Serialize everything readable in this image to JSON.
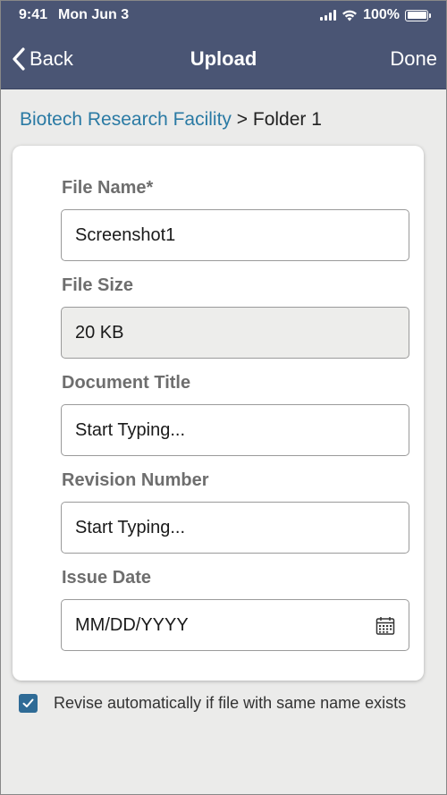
{
  "status": {
    "time": "9:41",
    "date": "Mon Jun 3",
    "battery": "100%"
  },
  "nav": {
    "back_label": "Back",
    "title": "Upload",
    "done_label": "Done"
  },
  "breadcrumb": {
    "parent": "Biotech Research Facility",
    "separator": " > ",
    "current": "Folder 1"
  },
  "form": {
    "file_name": {
      "label": "File Name*",
      "value": "Screenshot1"
    },
    "file_size": {
      "label": "File Size",
      "value": "20 KB"
    },
    "document_title": {
      "label": "Document Title",
      "placeholder": "Start Typing..."
    },
    "revision_number": {
      "label": "Revision Number",
      "placeholder": "Start Typing..."
    },
    "issue_date": {
      "label": "Issue Date",
      "placeholder": "MM/DD/YYYY"
    }
  },
  "revise": {
    "label": "Revise automatically if file with same name exists",
    "checked": true
  },
  "colors": {
    "header": "#4a5574",
    "link": "#2a7aa4",
    "checkbox": "#2f6b96"
  },
  "icons": [
    "chevron-left-icon",
    "wifi-icon",
    "signal-icon",
    "battery-icon",
    "calendar-icon",
    "checkmark-icon"
  ]
}
